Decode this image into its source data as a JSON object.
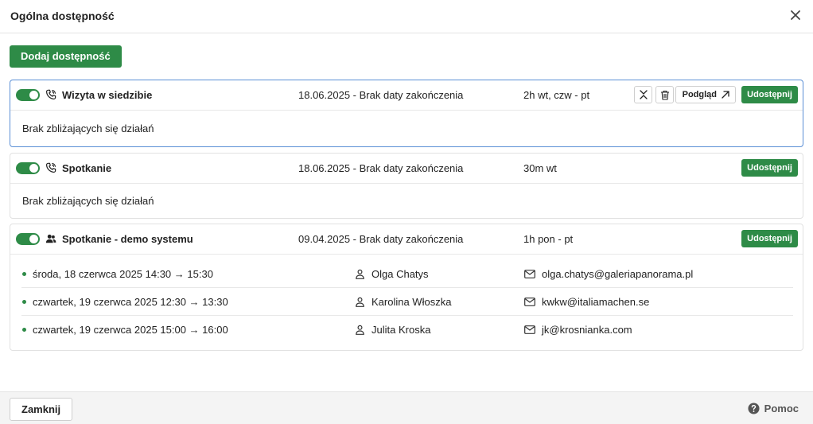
{
  "header": {
    "title": "Ogólna dostępność"
  },
  "add_button": "Dodaj dostępność",
  "actions": {
    "preview": "Podgląd",
    "share": "Udostępnij"
  },
  "cards": [
    {
      "name": "Wizyta w siedzibie",
      "dates": "18.06.2025 - Brak daty zakończenia",
      "schedule": "2h wt, czw - pt",
      "body": "Brak zbliżających się działań"
    },
    {
      "name": "Spotkanie",
      "dates": "18.06.2025 - Brak daty zakończenia",
      "schedule": "30m wt",
      "body": "Brak zbliżających się działań"
    },
    {
      "name": "Spotkanie - demo systemu",
      "dates": "09.04.2025 - Brak daty zakończenia",
      "schedule": "1h pon - pt",
      "events": [
        {
          "when": "środa, 18 czerwca 2025 14:30 → 15:30",
          "person": "Olga Chatys",
          "email": "olga.chatys@galeriapanorama.pl"
        },
        {
          "when": "czwartek, 19 czerwca 2025 12:30 → 13:30",
          "person": "Karolina Włoszka",
          "email": "kwkw@italiamachen.se"
        },
        {
          "when": "czwartek, 19 czerwca 2025 15:00 → 16:00",
          "person": "Julita Kroska",
          "email": "jk@krosnianka.com"
        }
      ]
    }
  ],
  "footer": {
    "close": "Zamknij",
    "help": "Pomoc"
  },
  "colors": {
    "accent": "#2e8b47",
    "selected_border": "#5b8fd6"
  }
}
